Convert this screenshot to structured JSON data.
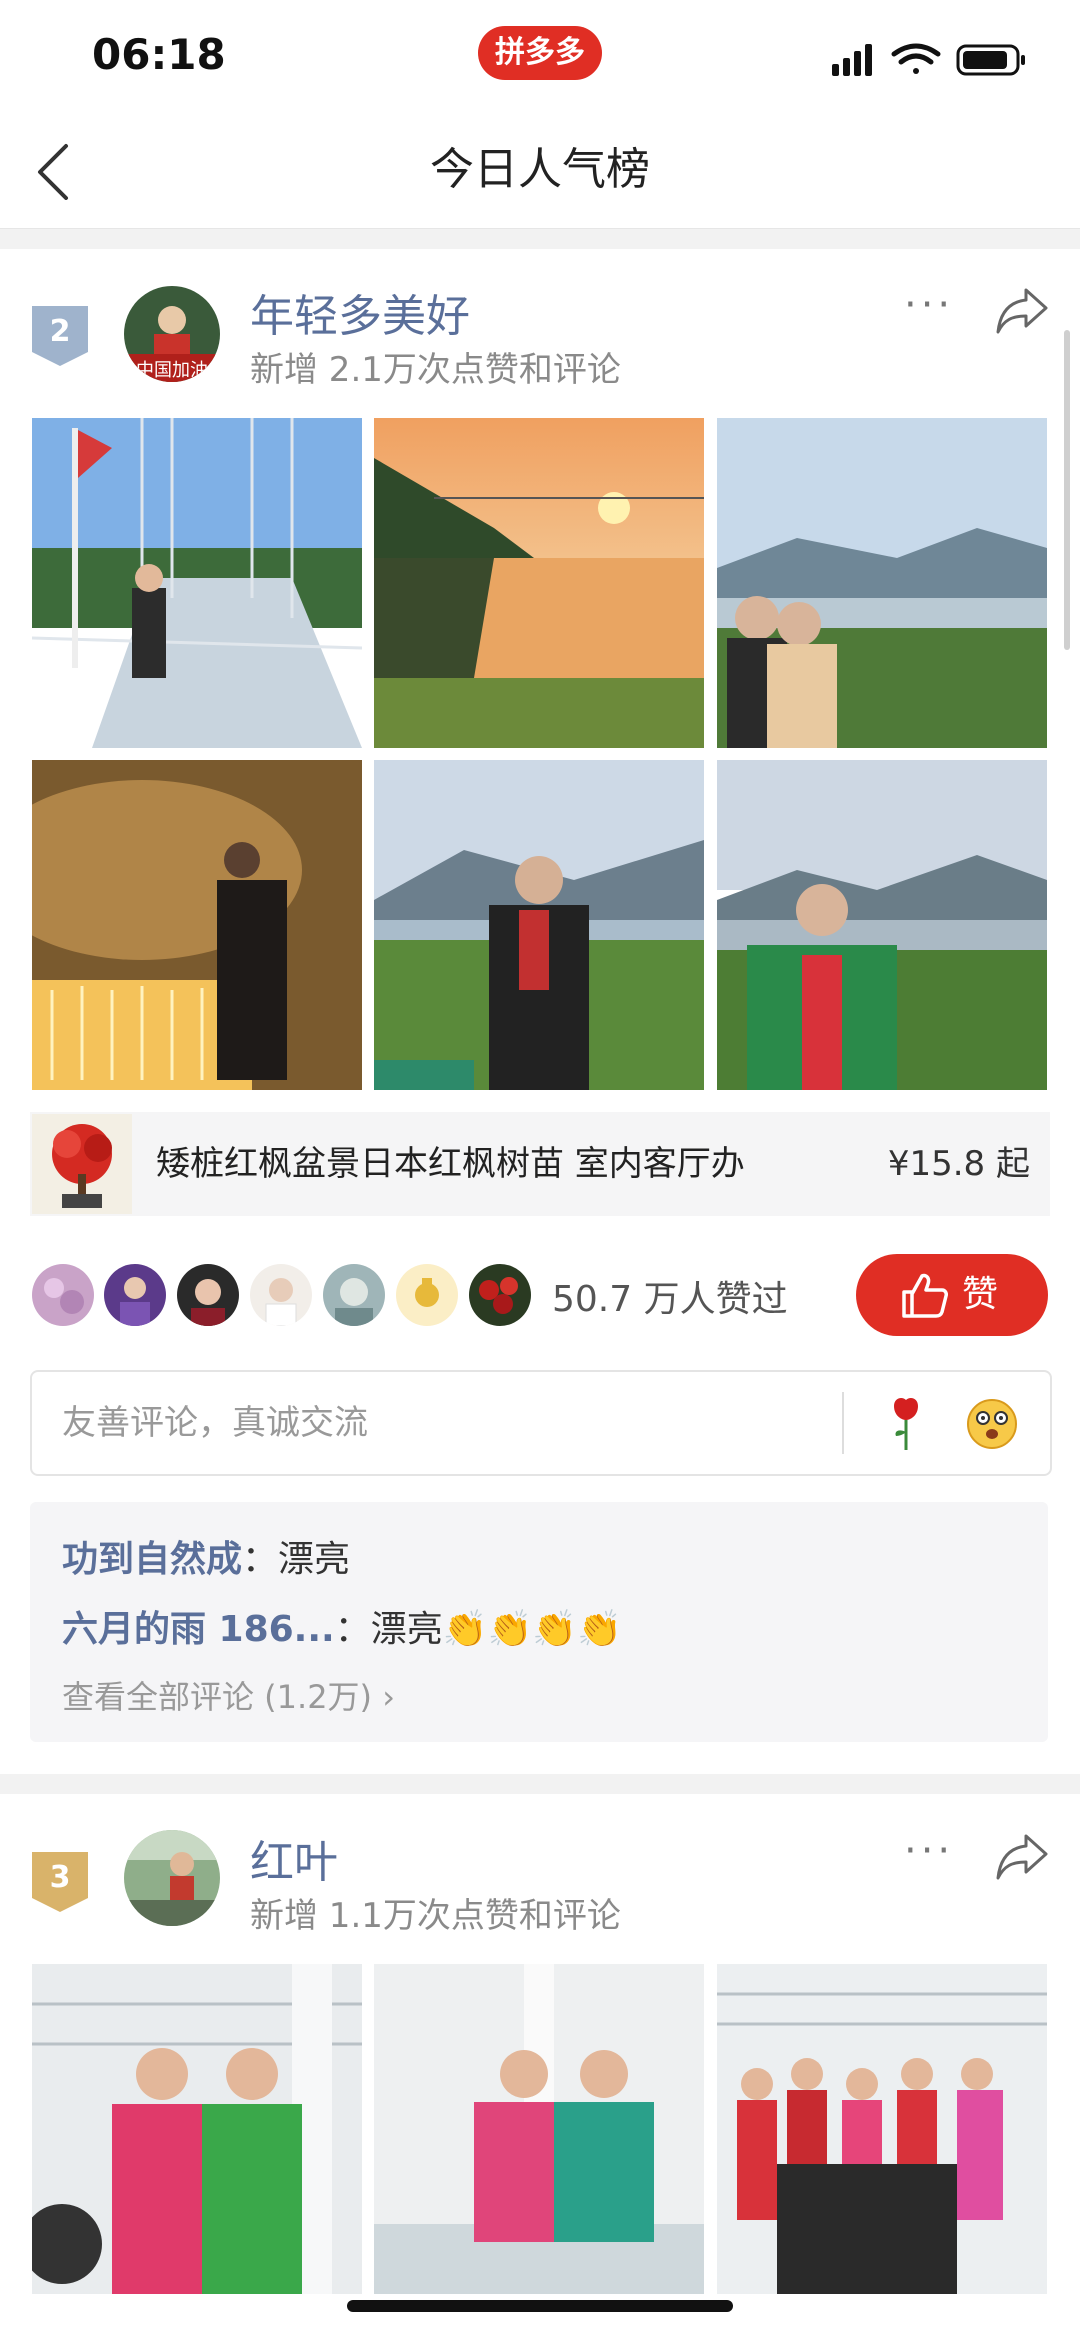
{
  "status_bar": {
    "time": "06:18",
    "app_badge": "拼多多"
  },
  "nav": {
    "title": "今日人气榜"
  },
  "posts": [
    {
      "rank": "2",
      "username": "年轻多美好",
      "avatar_caption": "中国加油",
      "subtitle": "新增 2.1万次点赞和评论",
      "more": "···",
      "product": {
        "title": "矮桩红枫盆景日本红枫树苗 室内客厅办",
        "price": "¥15.8 起"
      },
      "likes": "50.7 万人赞过",
      "like_button": "赞",
      "comment_placeholder": "友善评论，真诚交流",
      "comments": [
        {
          "user": "功到自然成",
          "sep": "：",
          "text": "漂亮"
        },
        {
          "user": "六月的雨 186...",
          "sep": "：",
          "text": "漂亮👏👏👏👏"
        }
      ],
      "view_all": "查看全部评论 (1.2万)"
    },
    {
      "rank": "3",
      "username": "红叶",
      "subtitle": "新增 1.1万次点赞和评论",
      "more": "···"
    }
  ],
  "icons": {
    "back": "chevron-left-icon",
    "share": "share-arrow-icon",
    "like": "thumbs-up-icon",
    "rose": "rose-icon",
    "emoji": "emoji-face-icon"
  },
  "colors": {
    "accent": "#e02e24",
    "username": "#5a6f9a"
  }
}
